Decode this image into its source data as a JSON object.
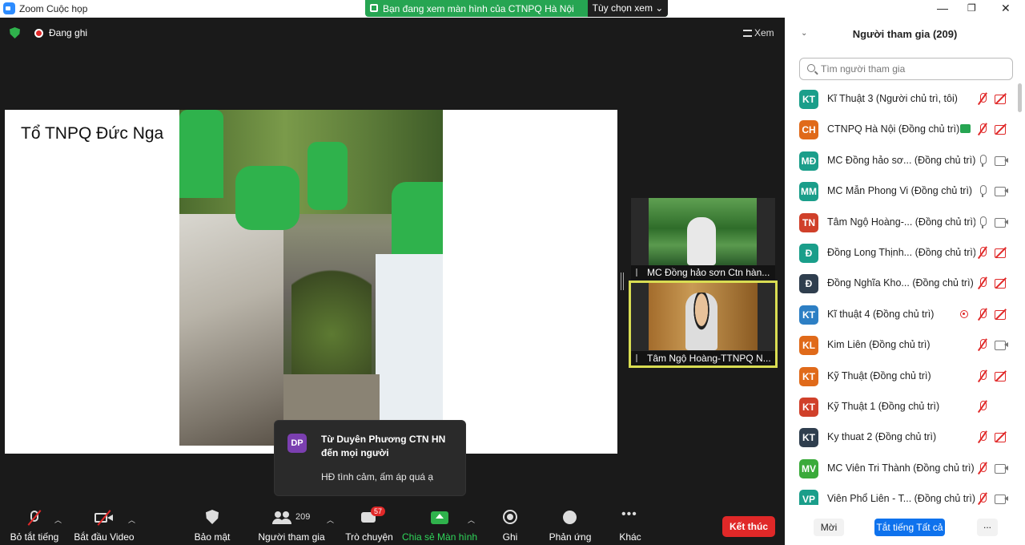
{
  "window": {
    "title": "Zoom Cuộc họp"
  },
  "share_bar": {
    "text": "Bạn đang xem màn hình của CTNPQ Hà Nội",
    "options": "Tùy chọn xem ⌄"
  },
  "status": {
    "recording": "Đang ghi",
    "view": "Xem"
  },
  "slide": {
    "title": "Tổ TNPQ Đức Nga"
  },
  "tiles": [
    {
      "name": "MC Đồng hảo sơn Ctn hàn..."
    },
    {
      "name": "Tâm Ngộ Hoàng-TTNPQ N..."
    }
  ],
  "toast": {
    "initials": "DP",
    "from": "Từ Duyên Phương CTN HN đến mọi người",
    "message": "HĐ tình cảm, ấm áp quá ạ"
  },
  "toolbar": {
    "mute": "Bỏ tắt tiếng",
    "video": "Bắt đầu Video",
    "security": "Bảo mật",
    "participants": "Người tham gia",
    "participants_count": "209",
    "chat": "Trò chuyện",
    "chat_badge": "57",
    "share": "Chia sẻ Màn hình",
    "record": "Ghi",
    "reactions": "Phản ứng",
    "more": "Khác",
    "end": "Kết thúc"
  },
  "panel": {
    "title": "Người tham gia (209)",
    "search_placeholder": "Tìm người tham gia",
    "participants": [
      {
        "initials": "KT",
        "color": "#1a9e8a",
        "name": "Kĩ Thuật 3 (Người chủ trì, tôi)",
        "mic": "off",
        "cam": "off"
      },
      {
        "initials": "CH",
        "color": "#e06a1a",
        "name": "CTNPQ Hà Nội (Đồng chủ trì)",
        "mic": "off",
        "cam": "off",
        "sharing": true
      },
      {
        "initials": "MĐ",
        "color": "#1a9e8a",
        "name": "MC Đồng hảo sơ... (Đồng chủ trì)",
        "mic": "on",
        "cam": "on"
      },
      {
        "initials": "MM",
        "color": "#1a9e8a",
        "name": "MC Mẫn Phong Vi (Đồng chủ trì)",
        "mic": "on",
        "cam": "on"
      },
      {
        "initials": "TN",
        "color": "#d0402a",
        "name": "Tâm Ngộ Hoàng-... (Đồng chủ trì)",
        "mic": "on",
        "cam": "on"
      },
      {
        "initials": "Đ",
        "color": "#1a9e8a",
        "name": "Đồng Long Thịnh... (Đồng chủ trì)",
        "mic": "off",
        "cam": "off"
      },
      {
        "initials": "Đ",
        "color": "#2f3e4e",
        "name": "Đồng Nghĩa Kho... (Đồng chủ trì)",
        "mic": "off",
        "cam": "off"
      },
      {
        "initials": "KT",
        "color": "#2d7fc4",
        "name": "Kĩ thuật 4 (Đồng chủ trì)",
        "mic": "off",
        "cam": "off",
        "recording": true
      },
      {
        "initials": "KL",
        "color": "#e06a1a",
        "name": "Kim Liên (Đồng chủ trì)",
        "mic": "off",
        "cam": "on"
      },
      {
        "initials": "KT",
        "color": "#e06a1a",
        "name": "Kỹ Thuật (Đồng chủ trì)",
        "mic": "off",
        "cam": "off"
      },
      {
        "initials": "KT",
        "color": "#d0402a",
        "name": "Kỹ Thuật 1 (Đồng chủ trì)",
        "mic": "off",
        "cam": "none"
      },
      {
        "initials": "KT",
        "color": "#2f3e4e",
        "name": "Ky thuat 2 (Đồng chủ trì)",
        "mic": "off",
        "cam": "off"
      },
      {
        "initials": "MV",
        "color": "#3aaa3a",
        "name": "MC Viên Tri Thành (Đồng chủ trì)",
        "mic": "off",
        "cam": "on"
      },
      {
        "initials": "VP",
        "color": "#1a9e8a",
        "name": "Viên Phổ Liên - T... (Đồng chủ trì)",
        "mic": "off",
        "cam": "on"
      }
    ],
    "invite": "Mời",
    "mute_all": "Tắt tiếng Tất cả",
    "more": "..."
  }
}
